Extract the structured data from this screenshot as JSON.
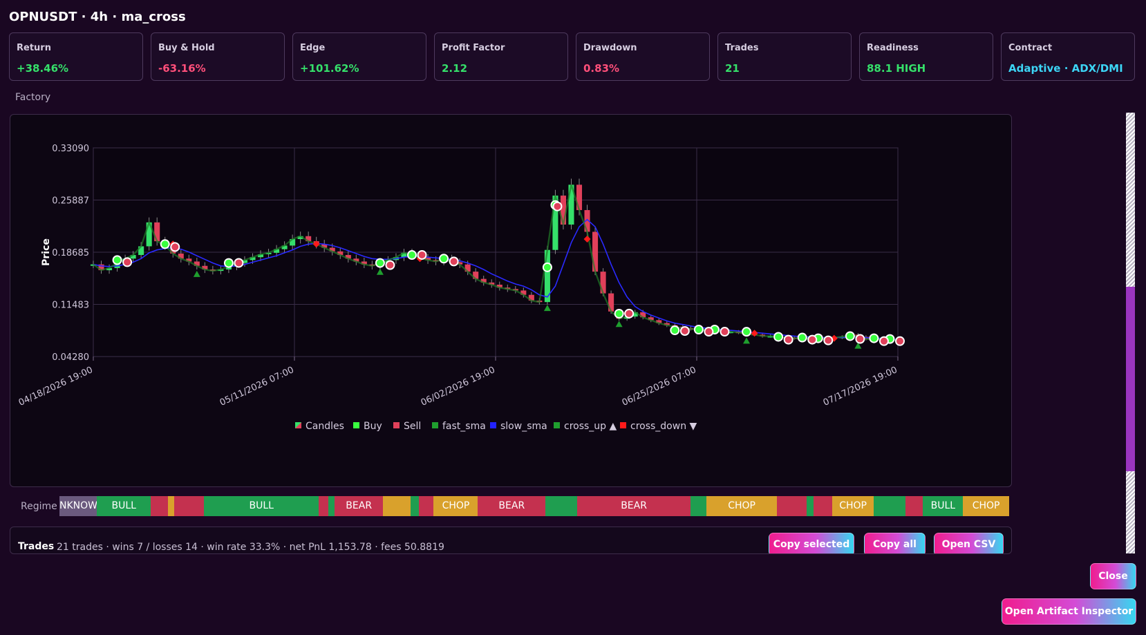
{
  "header": {
    "title": "OPNUSDT · 4h · ma_cross"
  },
  "cards": [
    {
      "label": "Return",
      "value": "+38.46%",
      "color": "#35e06a"
    },
    {
      "label": "Buy & Hold",
      "value": "-63.16%",
      "color": "#ff4f7a"
    },
    {
      "label": "Edge",
      "value": "+101.62%",
      "color": "#35e06a"
    },
    {
      "label": "Profit Factor",
      "value": "2.12",
      "color": "#35e06a"
    },
    {
      "label": "Drawdown",
      "value": "0.83%",
      "color": "#ff4f7a"
    },
    {
      "label": "Trades",
      "value": "21",
      "color": "#35e06a"
    },
    {
      "label": "Readiness",
      "value": "88.1 HIGH",
      "color": "#35e06a"
    },
    {
      "label": "Contract",
      "value": "Adaptive · ADX/DMI",
      "color": "#3cd5f5"
    }
  ],
  "section_label": "Factory",
  "chart_data": {
    "type": "line",
    "ylabel": "Price",
    "yticks": [
      "0.33090",
      "0.25887",
      "0.18685",
      "0.11483",
      "0.04280"
    ],
    "ylim": [
      0.0428,
      0.3309
    ],
    "xticks": [
      "04/18/2026 19:00",
      "05/11/2026 07:00",
      "06/02/2026 19:00",
      "06/25/2026 07:00",
      "07/17/2026 19:00"
    ],
    "grid": true,
    "legend_position": "bottom-center",
    "legend": [
      {
        "name": "Candles",
        "color": "#35e06a",
        "color2": "#e0405a"
      },
      {
        "name": "Buy",
        "color": "#39ff3f"
      },
      {
        "name": "Sell",
        "color": "#e0405a"
      },
      {
        "name": "fast_sma",
        "color": "#1f9e2e"
      },
      {
        "name": "slow_sma",
        "color": "#2222ff"
      },
      {
        "name": "cross_up ▲",
        "color": "#1f9e2e"
      },
      {
        "name": "cross_down ▼",
        "color": "#ff1a1a"
      }
    ],
    "close_series": [
      0.17,
      0.162,
      0.165,
      0.172,
      0.178,
      0.183,
      0.195,
      0.228,
      0.202,
      0.196,
      0.185,
      0.178,
      0.174,
      0.168,
      0.163,
      0.161,
      0.163,
      0.167,
      0.172,
      0.176,
      0.18,
      0.184,
      0.186,
      0.191,
      0.196,
      0.205,
      0.209,
      0.202,
      0.198,
      0.193,
      0.188,
      0.183,
      0.178,
      0.174,
      0.17,
      0.168,
      0.172,
      0.176,
      0.18,
      0.186,
      0.183,
      0.179,
      0.176,
      0.174,
      0.178,
      0.173,
      0.17,
      0.16,
      0.15,
      0.145,
      0.142,
      0.138,
      0.136,
      0.134,
      0.128,
      0.12,
      0.118,
      0.19,
      0.265,
      0.225,
      0.28,
      0.245,
      0.215,
      0.16,
      0.13,
      0.105,
      0.095,
      0.098,
      0.104,
      0.097,
      0.093,
      0.089,
      0.086,
      0.084,
      0.082,
      0.081,
      0.08,
      0.08,
      0.079,
      0.077,
      0.077,
      0.076,
      0.074,
      0.073,
      0.071,
      0.071,
      0.07,
      0.069,
      0.068,
      0.068,
      0.068,
      0.067,
      0.068,
      0.069,
      0.07,
      0.073,
      0.07,
      0.067,
      0.066,
      0.067,
      0.066,
      0.065
    ],
    "slow_sma": [
      0.17,
      0.168,
      0.167,
      0.168,
      0.17,
      0.173,
      0.178,
      0.186,
      0.19,
      0.192,
      0.193,
      0.191,
      0.187,
      0.182,
      0.177,
      0.172,
      0.168,
      0.167,
      0.168,
      0.17,
      0.173,
      0.176,
      0.179,
      0.182,
      0.186,
      0.19,
      0.195,
      0.198,
      0.199,
      0.198,
      0.196,
      0.193,
      0.189,
      0.185,
      0.181,
      0.178,
      0.177,
      0.177,
      0.178,
      0.18,
      0.181,
      0.181,
      0.18,
      0.179,
      0.178,
      0.177,
      0.175,
      0.172,
      0.168,
      0.163,
      0.157,
      0.152,
      0.147,
      0.143,
      0.14,
      0.135,
      0.128,
      0.125,
      0.14,
      0.17,
      0.2,
      0.222,
      0.232,
      0.222,
      0.198,
      0.17,
      0.145,
      0.125,
      0.112,
      0.105,
      0.1,
      0.096,
      0.092,
      0.089,
      0.087,
      0.085,
      0.083,
      0.082,
      0.081,
      0.08,
      0.079,
      0.078,
      0.077,
      0.076,
      0.075,
      0.074,
      0.073,
      0.072,
      0.071,
      0.07,
      0.07,
      0.069,
      0.069,
      0.069,
      0.069,
      0.07,
      0.07,
      0.069,
      0.068,
      0.068,
      0.067,
      0.066
    ],
    "buys": [
      [
        3,
        0.176
      ],
      [
        9,
        0.198
      ],
      [
        17,
        0.172
      ],
      [
        36,
        0.172
      ],
      [
        40,
        0.183
      ],
      [
        44,
        0.178
      ],
      [
        57,
        0.166
      ],
      [
        58,
        0.252
      ],
      [
        66,
        0.102
      ],
      [
        73,
        0.079
      ],
      [
        76,
        0.08
      ],
      [
        78,
        0.08
      ],
      [
        82,
        0.077
      ],
      [
        86,
        0.07
      ],
      [
        89,
        0.069
      ],
      [
        91,
        0.068
      ],
      [
        95,
        0.071
      ],
      [
        98,
        0.068
      ],
      [
        100,
        0.067
      ]
    ],
    "sells": [
      [
        4,
        0.175
      ],
      [
        10,
        0.196
      ],
      [
        18,
        0.174
      ],
      [
        37,
        0.171
      ],
      [
        41,
        0.185
      ],
      [
        45,
        0.176
      ],
      [
        58,
        0.252
      ],
      [
        67,
        0.104
      ],
      [
        74,
        0.08
      ],
      [
        77,
        0.079
      ],
      [
        79,
        0.079
      ],
      [
        87,
        0.068
      ],
      [
        90,
        0.068
      ],
      [
        92,
        0.067
      ],
      [
        96,
        0.069
      ],
      [
        99,
        0.066
      ],
      [
        101,
        0.066
      ]
    ],
    "cross_up": [
      [
        13,
        0.165
      ],
      [
        36,
        0.168
      ],
      [
        57,
        0.118
      ],
      [
        66,
        0.096
      ],
      [
        82,
        0.073
      ],
      [
        96,
        0.066
      ]
    ],
    "cross_down": [
      [
        10,
        0.198
      ],
      [
        28,
        0.198
      ],
      [
        41,
        0.178
      ],
      [
        62,
        0.205
      ],
      [
        67,
        0.103
      ],
      [
        83,
        0.075
      ],
      [
        93,
        0.068
      ],
      [
        100,
        0.066
      ]
    ]
  },
  "regime": {
    "label": "Regime",
    "segments": [
      {
        "label": "NKNOW",
        "color": "#6b5a7e",
        "w": 3.8
      },
      {
        "label": "BULL",
        "color": "#1f9e50",
        "w": 5.4
      },
      {
        "label": "",
        "color": "#c4314f",
        "w": 1.8
      },
      {
        "label": "",
        "color": "#d9a12c",
        "w": 0.6
      },
      {
        "label": "",
        "color": "#c4314f",
        "w": 3.0
      },
      {
        "label": "BULL",
        "color": "#1f9e50",
        "w": 11.6
      },
      {
        "label": "",
        "color": "#c4314f",
        "w": 1.0
      },
      {
        "label": "",
        "color": "#1f9e50",
        "w": 0.6
      },
      {
        "label": "BEAR",
        "color": "#c4314f",
        "w": 4.9
      },
      {
        "label": "",
        "color": "#d9a12c",
        "w": 2.8
      },
      {
        "label": "",
        "color": "#1f9e50",
        "w": 0.8
      },
      {
        "label": "",
        "color": "#c4314f",
        "w": 1.5
      },
      {
        "label": "CHOP",
        "color": "#d9a12c",
        "w": 4.5
      },
      {
        "label": "BEAR",
        "color": "#c4314f",
        "w": 6.8
      },
      {
        "label": "",
        "color": "#1f9e50",
        "w": 3.2
      },
      {
        "label": "BEAR",
        "color": "#c4314f",
        "w": 11.5
      },
      {
        "label": "",
        "color": "#1f9e50",
        "w": 1.6
      },
      {
        "label": "CHOP",
        "color": "#d9a12c",
        "w": 7.1
      },
      {
        "label": "",
        "color": "#c4314f",
        "w": 3.0
      },
      {
        "label": "",
        "color": "#1f9e50",
        "w": 0.7
      },
      {
        "label": "",
        "color": "#c4314f",
        "w": 1.9
      },
      {
        "label": "CHOP",
        "color": "#d9a12c",
        "w": 4.2
      },
      {
        "label": "",
        "color": "#1f9e50",
        "w": 3.2
      },
      {
        "label": "",
        "color": "#c4314f",
        "w": 1.8
      },
      {
        "label": "BULL",
        "color": "#1f9e50",
        "w": 4.0
      },
      {
        "label": "CHOP",
        "color": "#d9a12c",
        "w": 4.7
      }
    ]
  },
  "trades": {
    "title": "Trades",
    "summary": "21 trades · wins 7 / losses 14 · win rate 33.3% · net PnL 1,153.78 · fees 50.8819",
    "copy_selected_label": "Copy selected",
    "copy_all_label": "Copy all",
    "open_csv_label": "Open CSV"
  },
  "footer": {
    "close_label": "Close",
    "inspector_label": "Open Artifact Inspector"
  }
}
